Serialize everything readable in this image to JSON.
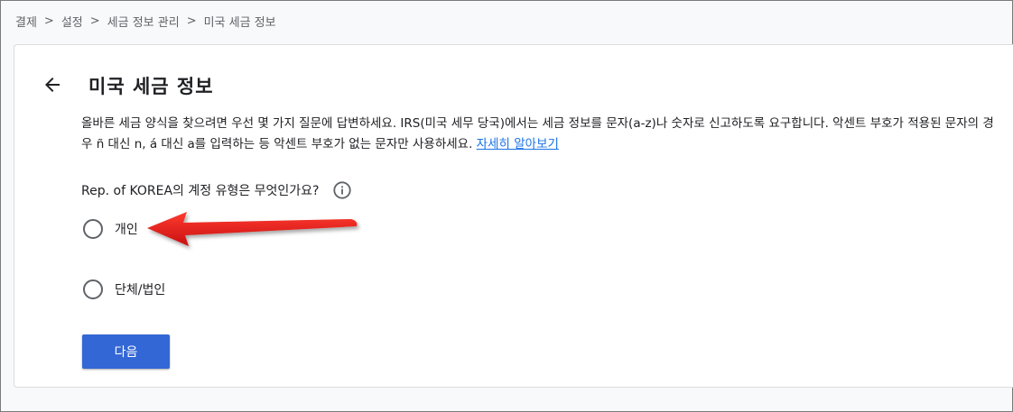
{
  "breadcrumb": [
    "결제",
    "설정",
    "세금 정보 관리",
    "미국 세금 정보"
  ],
  "breadcrumb_separator": ">",
  "page": {
    "title": "미국 세금 정보",
    "intro_text": "올바른 세금 양식을 찾으려면 우선 몇 가지 질문에 답변하세요. IRS(미국 세무 당국)에서는 세금 정보를 문자(a-z)나 숫자로 신고하도록 요구합니다. 악센트 부호가 적용된 문자의 경우 ñ 대신 n, á 대신 a를 입력하는 등 악센트 부호가 없는 문자만 사용하세요.",
    "learn_more_link": "자세히 알아보기"
  },
  "question": {
    "label": "Rep. of KOREA의 계정 유형은 무엇인가요?",
    "options": [
      "개인",
      "단체/법인"
    ],
    "selected": null
  },
  "next_button": "다음",
  "colors": {
    "primary_button": "#3367d6",
    "link": "#1a73e8",
    "annotation_arrow": "#e0201f"
  },
  "icons": {
    "back": "arrow-left-icon",
    "info": "info-icon"
  }
}
